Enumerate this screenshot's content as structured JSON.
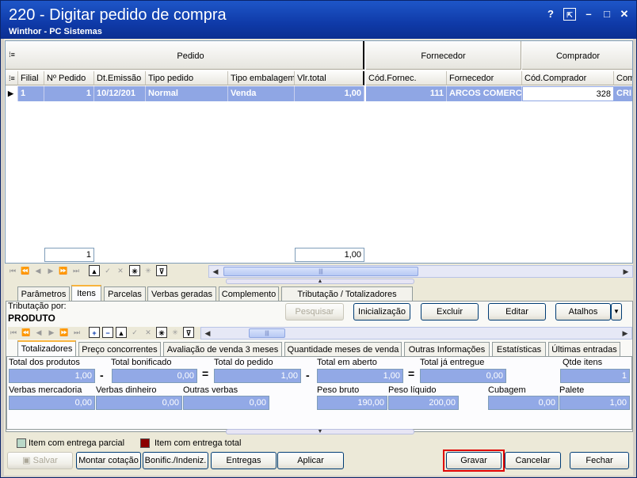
{
  "window": {
    "title": "220 - Digitar pedido de compra",
    "subtitle": "Winthor - PC Sistemas",
    "controls": [
      "?",
      "⇱",
      "–",
      "□",
      "✕"
    ]
  },
  "grid": {
    "groups": [
      {
        "label": "Pedido"
      },
      {
        "label": "Fornecedor"
      },
      {
        "label": "Comprador"
      }
    ],
    "columns": [
      "Filial",
      "Nº Pedido",
      "Dt.Emissão",
      "Tipo pedido",
      "Tipo embalagem",
      "Vlr.total",
      "Cód.Fornec.",
      "Fornecedor",
      "Cód.Comprador",
      "Com"
    ],
    "rows": [
      [
        "1",
        "1",
        "10/12/201",
        "Normal",
        "Venda",
        "1,00",
        "111",
        "ARCOS COMERCI",
        "328",
        "CRI"
      ]
    ],
    "footer": {
      "count": "1",
      "total": "1,00"
    },
    "scroll_thumb": "|||"
  },
  "tabs_top": {
    "items": [
      "Parâmetros",
      "Itens",
      "Parcelas",
      "Verbas geradas",
      "Complemento",
      "Tributação / Totalizadores"
    ],
    "active": "Itens"
  },
  "items_panel": {
    "tributacao_label": "Tributação por:",
    "tributacao_value": "PRODUTO",
    "buttons": {
      "pesquisar": "Pesquisar",
      "inicializacao": "Inicialização",
      "excluir": "Excluir",
      "editar": "Editar",
      "atalhos": "Atalhos"
    }
  },
  "tabs_bottom": {
    "items": [
      "Totalizadores",
      "Preço concorrentes",
      "Avaliação de venda 3 meses",
      "Quantidade meses de venda",
      "Outras Informações",
      "Estatísticas",
      "Últimas entradas"
    ],
    "active": "Totalizadores"
  },
  "totals": {
    "total_produtos": {
      "label": "Total dos produtos",
      "value": "1,00"
    },
    "total_bonificado": {
      "label": "Total bonificado",
      "value": "0,00"
    },
    "total_pedido": {
      "label": "Total do pedido",
      "value": "1,00"
    },
    "total_aberto": {
      "label": "Total  em aberto",
      "value": "1,00"
    },
    "total_entregue": {
      "label": "Total já entregue",
      "value": "0,00"
    },
    "qtde_itens": {
      "label": "Qtde itens",
      "value": "1"
    },
    "verbas_mercadoria": {
      "label": "Verbas mercadoria",
      "value": "0,00"
    },
    "verbas_dinheiro": {
      "label": "Verbas dinheiro",
      "value": "0,00"
    },
    "outras_verbas": {
      "label": "Outras verbas",
      "value": "0,00"
    },
    "peso_bruto": {
      "label": "Peso bruto",
      "value": "190,00"
    },
    "peso_liquido": {
      "label": "Peso líquido",
      "value": "200,00"
    },
    "cubagem": {
      "label": "Cubagem",
      "value": "0,00"
    },
    "palete": {
      "label": "Palete",
      "value": "1,00"
    },
    "ops": {
      "minus": "-",
      "equals": "="
    }
  },
  "legend": {
    "parcial": {
      "label": "Item com entrega parcial",
      "color": "#b9d8c8"
    },
    "total": {
      "label": "Item com entrega total",
      "color": "#8b0000"
    }
  },
  "footer_buttons": {
    "salvar": "Salvar",
    "montar": "Montar cotação",
    "bonific": "Bonific./Indeniz.",
    "entregas": "Entregas",
    "aplicar": "Aplicar",
    "gravar": "Gravar",
    "cancelar": "Cancelar",
    "fechar": "Fechar"
  },
  "colors": {
    "titlebar": "#1e56c8",
    "selection": "#8fa6e4",
    "highlight_border": "#e00000"
  }
}
